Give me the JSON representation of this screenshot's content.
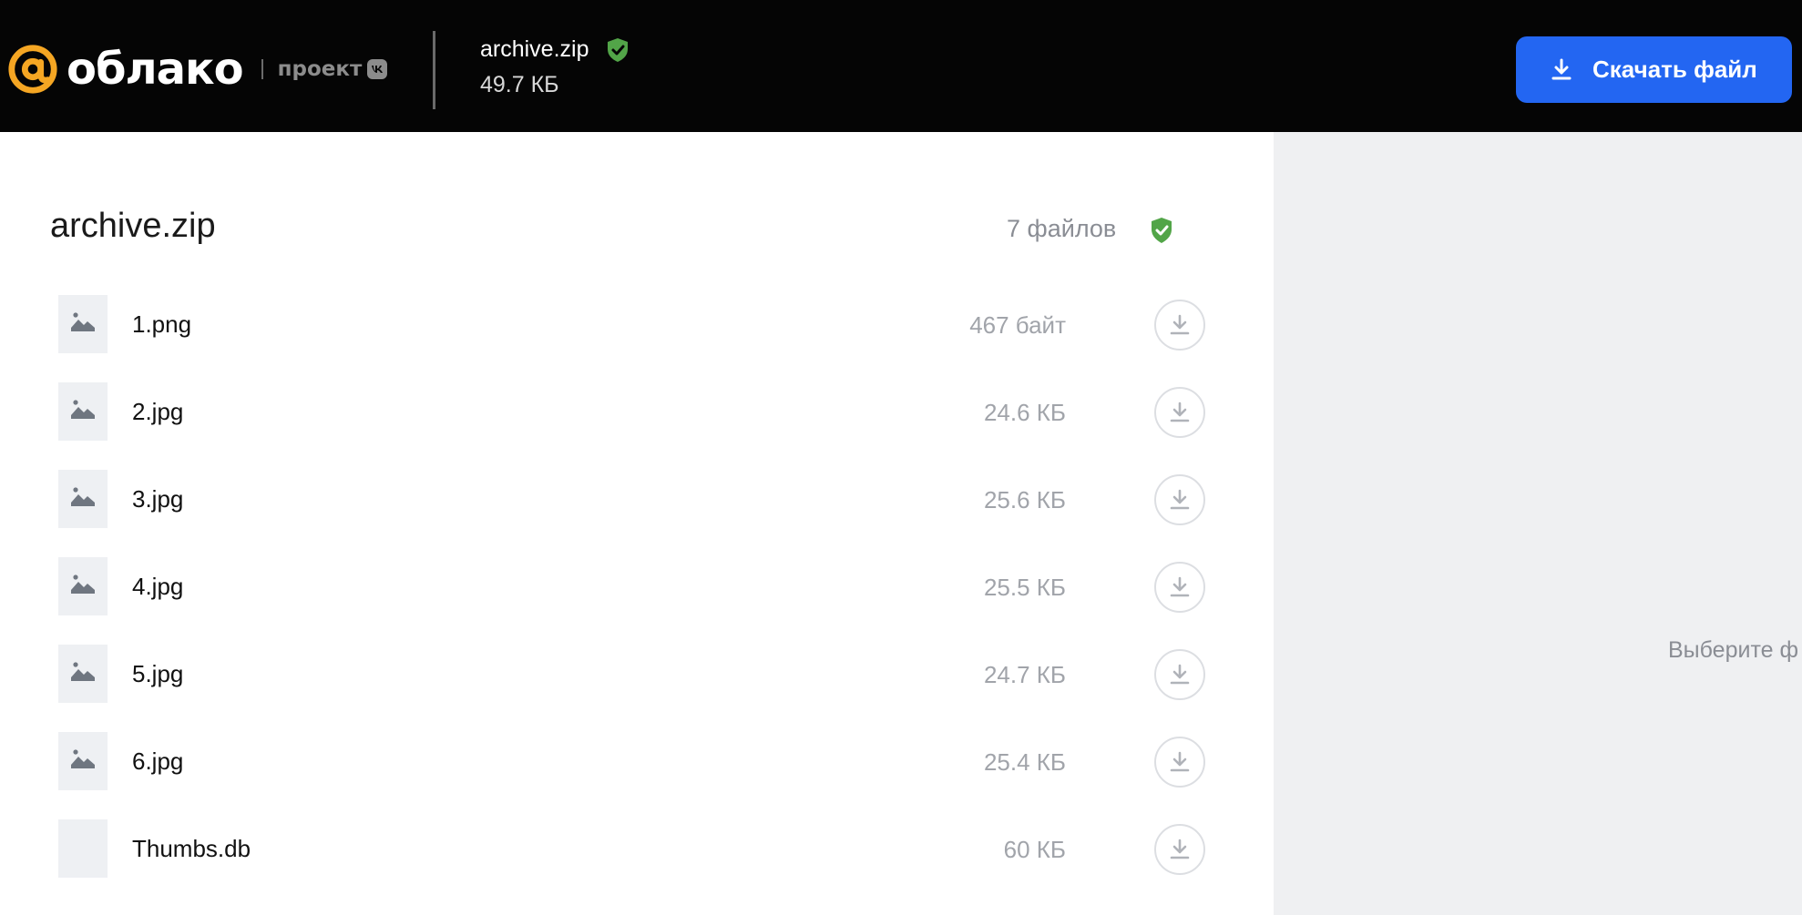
{
  "header": {
    "logo_text": "облако",
    "project_text": "проект",
    "file_name": "archive.zip",
    "file_size": "49.7 КБ",
    "download_label": "Скачать файл"
  },
  "archive": {
    "title": "archive.zip",
    "file_count": "7 файлов"
  },
  "files": [
    {
      "name": "1.png",
      "size": "467 байт",
      "type": "image"
    },
    {
      "name": "2.jpg",
      "size": "24.6 КБ",
      "type": "image"
    },
    {
      "name": "3.jpg",
      "size": "25.6 КБ",
      "type": "image"
    },
    {
      "name": "4.jpg",
      "size": "25.5 КБ",
      "type": "image"
    },
    {
      "name": "5.jpg",
      "size": "24.7 КБ",
      "type": "image"
    },
    {
      "name": "6.jpg",
      "size": "25.4 КБ",
      "type": "image"
    },
    {
      "name": "Thumbs.db",
      "size": "60 КБ",
      "type": "file"
    }
  ],
  "preview": {
    "hint": "Выберите ф"
  },
  "colors": {
    "topbar": "#050505",
    "accent_orange": "#f5a623",
    "primary_blue": "#2366f2",
    "shield_green": "#52a548",
    "panel_gray": "#eff0f2"
  },
  "icons": {
    "logo": "at-sign-logo",
    "safe": "shield-check-icon",
    "download": "download-icon",
    "image_file": "image-file-icon",
    "generic_file": "file-icon"
  }
}
